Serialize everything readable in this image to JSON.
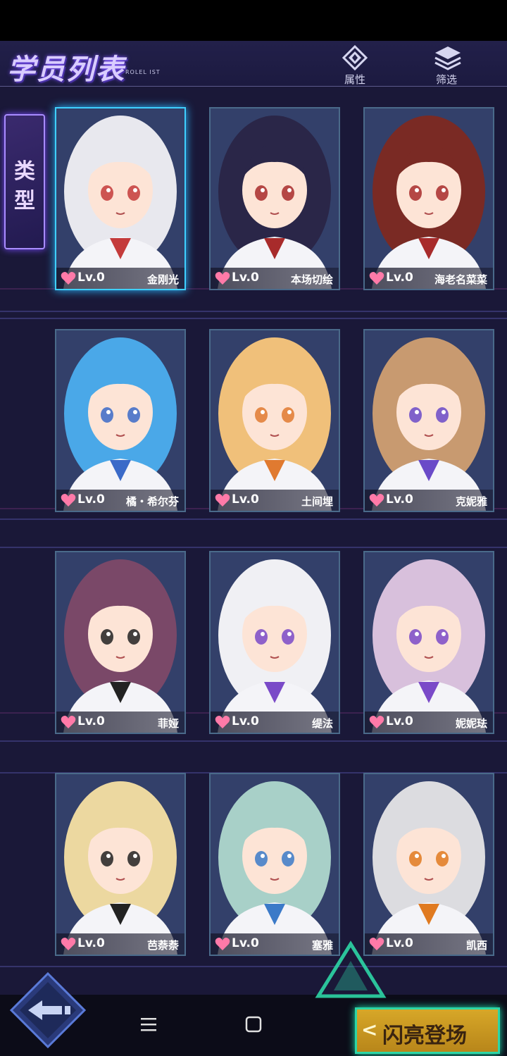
{
  "header": {
    "title": "学员列表",
    "subtitle": "ROLEL IST",
    "attr_label": "属性",
    "filter_label": "筛选"
  },
  "sidebar": {
    "type_tab": [
      "类",
      "型"
    ]
  },
  "cards": [
    {
      "level": "Lv.0",
      "name": "金刚光",
      "hair": "#e8e8ee",
      "accent": "#c43b3b"
    },
    {
      "level": "Lv.0",
      "name": "本场切绘",
      "hair": "#2a2648",
      "accent": "#a82b2b"
    },
    {
      "level": "Lv.0",
      "name": "海老名菜菜",
      "hair": "#7a2a24",
      "accent": "#a82b2b"
    },
    {
      "level": "Lv.0",
      "name": "橘・希尔芬",
      "hair": "#4aa8e8",
      "accent": "#3b6ac8"
    },
    {
      "level": "Lv.0",
      "name": "土间埋",
      "hair": "#f0c07a",
      "accent": "#e07a30"
    },
    {
      "level": "Lv.0",
      "name": "克妮雅",
      "hair": "#c89a70",
      "accent": "#6a4ac8"
    },
    {
      "level": "Lv.0",
      "name": "菲娅",
      "hair": "#7a4868",
      "accent": "#222222"
    },
    {
      "level": "Lv.0",
      "name": "缇法",
      "hair": "#f0f0f4",
      "accent": "#7a4ac8"
    },
    {
      "level": "Lv.0",
      "name": "妮妮珐",
      "hair": "#d8c0dc",
      "accent": "#7a4ac8"
    },
    {
      "level": "Lv.0",
      "name": "芭萘萘",
      "hair": "#ecd8a0",
      "accent": "#222222"
    },
    {
      "level": "Lv.0",
      "name": "塞雅",
      "hair": "#a8d0c8",
      "accent": "#3b7ac8"
    },
    {
      "level": "Lv.0",
      "name": "凯西",
      "hair": "#dcdce0",
      "accent": "#e07a20"
    }
  ],
  "footer": {
    "flash_label": "闪亮登场",
    "flash_chevron": "<"
  },
  "colors": {
    "bg": "#1a1838",
    "heart": "#ff7aa8",
    "flash_gold": "#d7a728",
    "flash_border": "#2dd6a6"
  }
}
